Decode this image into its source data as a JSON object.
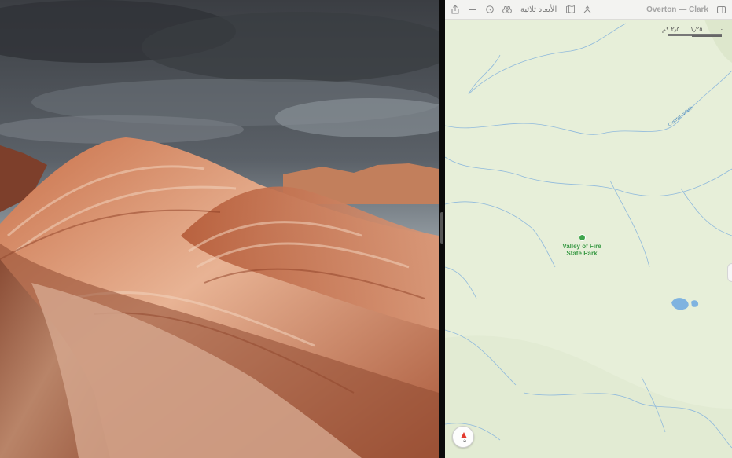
{
  "window": {
    "left_pane": "photo",
    "right_pane": "maps"
  },
  "map": {
    "title": "Overton — Clark",
    "toolbar": {
      "share_icon": "share-icon",
      "add_icon": "plus-icon",
      "tracking_icon": "location-tracking-icon",
      "lookaround_icon": "binoculars-icon",
      "three_d_label": "الأبعاد ثلاثية",
      "map_mode_icon": "map-icon",
      "directions_icon": "directions-icon",
      "sidebar_icon": "sidebar-icon"
    },
    "scale": {
      "zero": "٠",
      "mid": "١٫٢٥",
      "end": "٢٫٥ كم"
    },
    "places": {
      "park_line1": "Valley of Fire",
      "park_line2": "State Park",
      "river": "Overton Wash"
    },
    "compass": {
      "label": "ش"
    },
    "colors": {
      "land": "#e7efd9",
      "water": "#7fb3e0",
      "park": "#3fa54c"
    }
  }
}
